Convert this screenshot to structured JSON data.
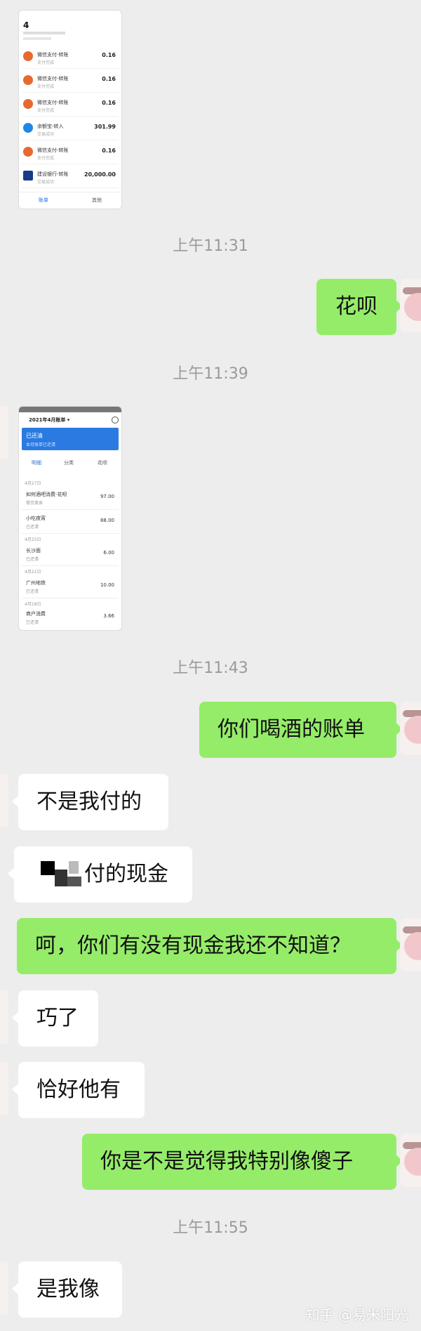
{
  "screenshot1": {
    "header_count": "4",
    "transactions": [
      {
        "name": "微信支付-转账",
        "sub": "支付完成",
        "amount": "0.16",
        "icon_color": "#e8692f"
      },
      {
        "name": "微信支付-转账",
        "sub": "支付完成",
        "amount": "0.16",
        "icon_color": "#e8692f"
      },
      {
        "name": "微信支付-转账",
        "sub": "支付完成",
        "amount": "0.16",
        "icon_color": "#e8692f"
      },
      {
        "name": "余额宝-转入",
        "sub": "交易成功",
        "amount": "301.99",
        "icon_color": "#1e88e5"
      },
      {
        "name": "微信支付-转账",
        "sub": "支付完成",
        "amount": "0.16",
        "icon_color": "#e8692f"
      },
      {
        "name": "建设银行-转账",
        "sub": "交易成功",
        "amount": "20,000.00",
        "icon_color": "#1a3a8a"
      }
    ],
    "tab_bill": "账单",
    "tab_other": "其他"
  },
  "screenshot2": {
    "title": "2021年4月账单 ▾",
    "banner_title": "已还清",
    "banner_sub": "本月账单已还清",
    "tabs": [
      "明细",
      "分类",
      "花呗"
    ],
    "groups": [
      {
        "head": "4月27日",
        "rows": [
          {
            "name": "如何酒吧消费-花呗",
            "sub": "餐饮美食",
            "amount": "97.00"
          },
          {
            "name": "小吃夜宵",
            "sub": "已还清",
            "amount": "88.00"
          }
        ]
      },
      {
        "head": "4月25日",
        "rows": [
          {
            "name": "长沙面",
            "sub": "已还清",
            "amount": "6.00"
          }
        ]
      },
      {
        "head": "4月21日",
        "rows": [
          {
            "name": "广州地铁",
            "sub": "已还清",
            "amount": "10.00"
          }
        ]
      },
      {
        "head": "4月18日",
        "rows": [
          {
            "name": "商户消费",
            "sub": "已还清",
            "amount": "3.66"
          }
        ]
      }
    ]
  },
  "timestamps": [
    "上午11:31",
    "上午11:39",
    "上午11:43",
    "上午11:55"
  ],
  "messages": [
    {
      "side": "me",
      "text": "花呗"
    },
    {
      "side": "me",
      "text": "你们喝酒的账单"
    },
    {
      "side": "them",
      "text": "不是我付的"
    },
    {
      "side": "them",
      "text": "付的现金"
    },
    {
      "side": "me",
      "text": "呵，你们有没有现金我还不知道？"
    },
    {
      "side": "them",
      "text": "巧了"
    },
    {
      "side": "them",
      "text": "恰好他有"
    },
    {
      "side": "me",
      "text": "你是不是觉得我特别像傻子"
    },
    {
      "side": "them",
      "text": "是我像"
    }
  ],
  "watermark": "知乎 @易米阳光",
  "colors": {
    "background": "#ededed",
    "me_bubble": "#95ec69",
    "them_bubble": "#ffffff",
    "timestamp": "#9a9a9a"
  }
}
